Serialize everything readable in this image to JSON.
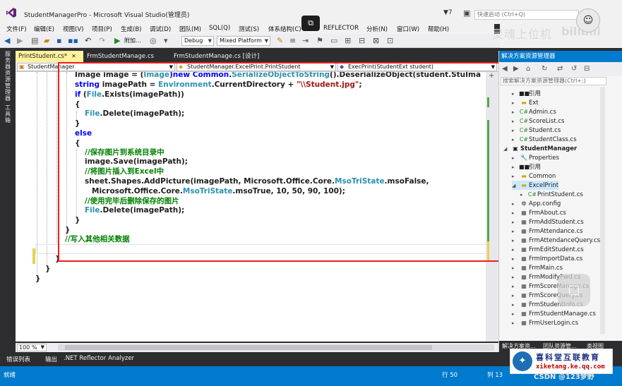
{
  "window": {
    "title": "StudentManagerPro - Microsoft Visual Studio(管理员)",
    "filter_count": "7",
    "quick_launch_placeholder": "快速启动 (Ctrl+Q)"
  },
  "menu": [
    "文件(F)",
    "编辑(E)",
    "视图(V)",
    "项目(P)",
    "生成(B)",
    "调试(D)",
    "团队(M)",
    "SQL(Q)",
    "测试(S)",
    "体系结构(C)",
    "REFLECTOR",
    "分析(N)",
    "窗口(W)",
    "帮助(H)"
  ],
  "toolbar": {
    "config": "Debug",
    "platform": "Mixed Platform"
  },
  "left_strip": {
    "server_explorer": "服务器资源管理器",
    "toolbox": "工具箱"
  },
  "tabs": [
    {
      "label": "PrintStudent.cs*",
      "close": "✕"
    },
    {
      "label": "FrmStudentManage.cs",
      "close": ""
    },
    {
      "label": "FrmStudentManage.cs [设计]",
      "close": ""
    }
  ],
  "nav": {
    "project": "StudentManager",
    "member_scope": "StudentManager.ExcelPrint.PrintStudent",
    "method": "ExecPrint(StudentExt student)"
  },
  "code": {
    "l1_a": "Image image = (",
    "l1_b": "Image",
    "l1_c": ")new Common.",
    "l1_d": "SerializeObjectToString",
    "l1_e": "().DeserializeObject(student.StuIma",
    "l2_a": "string",
    "l2_b": " imagePath = ",
    "l2_c": "Environment",
    "l2_d": ".CurrentDirectory + ",
    "l2_e": "\"\\\\Student.jpg\"",
    "l2_f": ";",
    "l3_a": "if",
    "l3_b": " (",
    "l3_c": "File",
    "l3_d": ".Exists(imagePath))",
    "l4": "{",
    "l5_a": "File",
    "l5_b": ".Delete(imagePath);",
    "l6": "}",
    "l7": "else",
    "l8": "{",
    "l9": "//保存图片到系统目录中",
    "l10": "image.Save(imagePath);",
    "l11": "//将图片插入到Excel中",
    "l12_a": "sheet.Shapes.AddPicture(imagePath, Microsoft.Office.Core.",
    "l12_b": "MsoTriState",
    "l12_c": ".msoFalse,",
    "l13_a": "Microsoft.Office.Core.",
    "l13_b": "MsoTriState",
    "l13_c": ".msoTrue, 10, 50, 90, 100);",
    "l14": "//使用完毕后删除保存的图片",
    "l15_a": "File",
    "l15_b": ".Delete(imagePath);",
    "l16": "}",
    "l17": "}",
    "l18": "//写入其他相关数据",
    "l19": "}",
    "l20": "}",
    "l21": "}"
  },
  "zoom": "100 %",
  "output_tabs": [
    "错误列表",
    "输出",
    ".NET Reflector Analyzer"
  ],
  "status": {
    "ready": "就绪",
    "row": "行 50",
    "col": "列 13"
  },
  "solution_explorer": {
    "title": "解决方案资源管理器",
    "search_placeholder": "搜索解决方案资源管理器(Ctrl+;)",
    "items": [
      {
        "label": "引用",
        "icon": "■■",
        "level": 2
      },
      {
        "label": "Ext",
        "icon": "▬",
        "level": 2
      },
      {
        "label": "Admin.cs",
        "icon": "C#",
        "level": 2
      },
      {
        "label": "ScoreList.cs",
        "icon": "C#",
        "level": 2
      },
      {
        "label": "Student.cs",
        "icon": "C#",
        "level": 2
      },
      {
        "label": "StudentClass.cs",
        "icon": "C#",
        "level": 2
      },
      {
        "label": "StudentManager",
        "icon": "▣",
        "level": 1
      },
      {
        "label": "Properties",
        "icon": "🔧",
        "level": 2
      },
      {
        "label": "引用",
        "icon": "■■",
        "level": 2
      },
      {
        "label": "Common",
        "icon": "▬",
        "level": 2
      },
      {
        "label": "ExcelPrint",
        "icon": "▬",
        "level": 2
      },
      {
        "label": "PrintStudent.cs",
        "icon": "C#",
        "level": 3
      },
      {
        "label": "App.config",
        "icon": "⚙",
        "level": 2
      },
      {
        "label": "FrmAbout.cs",
        "icon": "▦",
        "level": 2
      },
      {
        "label": "FrmAddStudent.cs",
        "icon": "▦",
        "level": 2
      },
      {
        "label": "FrmAttendance.cs",
        "icon": "▦",
        "level": 2
      },
      {
        "label": "FrmAttendanceQuery.cs",
        "icon": "▦",
        "level": 2
      },
      {
        "label": "FrmEditStudent.cs",
        "icon": "▦",
        "level": 2
      },
      {
        "label": "FrmImportData.cs",
        "icon": "▦",
        "level": 2
      },
      {
        "label": "FrmMain.cs",
        "icon": "▦",
        "level": 2
      },
      {
        "label": "FrmModifyPwd.cs",
        "icon": "▦",
        "level": 2
      },
      {
        "label": "FrmScoreManage.cs",
        "icon": "▦",
        "level": 2
      },
      {
        "label": "FrmScoreQuery.cs",
        "icon": "▦",
        "level": 2
      },
      {
        "label": "FrmStudentInfo.cs",
        "icon": "▦",
        "level": 2
      },
      {
        "label": "FrmStudentManage.cs",
        "icon": "▦",
        "level": 2
      },
      {
        "label": "FrmUserLogin.cs",
        "icon": "▦",
        "level": 2
      }
    ],
    "bottom_tabs": [
      "解决方案资...",
      "团队资源管...",
      "类视图"
    ]
  },
  "overlay": {
    "watermark": "灵魂上位机",
    "bili": "bilibili",
    "brand_name": "喜科堂互联教育",
    "brand_url": "xiketang.ke.qq.com",
    "csdn": "CSDN @123梦野"
  },
  "colors": {
    "accent_blue": "#007acc",
    "highlight_red": "#e8211e",
    "tab_active": "#fff29d",
    "keyword": "#0000ff",
    "type": "#2b91af",
    "comment": "#008000",
    "string": "#a31515"
  }
}
